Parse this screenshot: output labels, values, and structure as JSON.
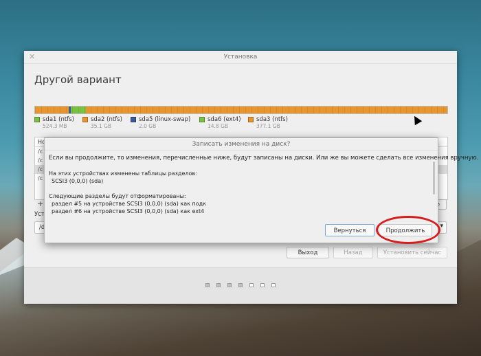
{
  "window": {
    "title": "Установка",
    "heading": "Другой вариант"
  },
  "partitions": [
    {
      "name": "sda1 (ntfs)",
      "size": "524.3 MB",
      "color": "#7ac143"
    },
    {
      "name": "sda2 (ntfs)",
      "size": "35.1 GB",
      "color": "#e8942f"
    },
    {
      "name": "sda5 (linux-swap)",
      "size": "2.0 GB",
      "color": "#3b5b9c"
    },
    {
      "name": "sda6 (ext4)",
      "size": "14.8 GB",
      "color": "#7ac143"
    },
    {
      "name": "sda3 (ntfs)",
      "size": "377.1 GB",
      "color": "#e8942f"
    }
  ],
  "table": {
    "header": "Но",
    "rows": [
      "/c",
      "/c",
      "/c",
      "/c"
    ]
  },
  "controls": {
    "add_symbol": "+",
    "right_button": "в",
    "boot_label": "Уст",
    "boot_value": "/d",
    "boot_arrow": "▾"
  },
  "buttons": {
    "quit": "Выход",
    "back": "Назад",
    "install": "Установить сейчас"
  },
  "dialog": {
    "title": "Записать изменения на диск?",
    "message": "Если вы продолжите, то изменения, перечисленные ниже, будут записаны на диски. Или же вы можете сделать все изменения вручную.",
    "section1_title": "На этих устройствах изменены таблицы разделов:",
    "section1_items": [
      "SCSI3 (0,0,0) (sda)"
    ],
    "section2_title": "Следующие разделы будут отформатированы:",
    "section2_items": [
      "раздел #5 на устройстве SCSI3 (0,0,0) (sda) как подк",
      "раздел #6 на устройстве SCSI3 (0,0,0) (sda) как ext4"
    ],
    "back_label": "Вернуться",
    "continue_label": "Продолжить"
  },
  "progress_dots": {
    "done": 4,
    "total": 7
  }
}
